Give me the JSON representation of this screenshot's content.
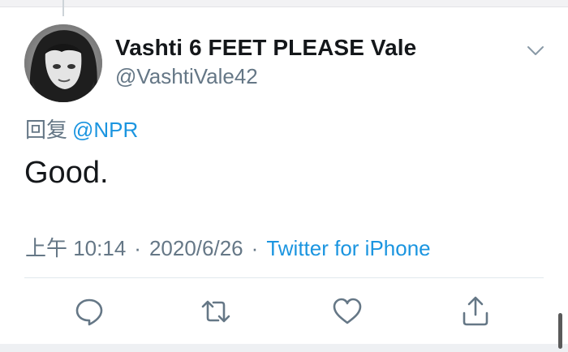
{
  "tweet": {
    "author": {
      "display_name": "Vashti 6 FEET PLEASE Vale",
      "handle": "@VashtiVale42"
    },
    "reply": {
      "prefix": "回复",
      "target": "@NPR"
    },
    "text": "Good.",
    "meta": {
      "time": "上午 10:14",
      "separator": "·",
      "date": "2020/6/26",
      "source": "Twitter for iPhone"
    },
    "actions": {
      "reply_icon": "reply-icon",
      "retweet_icon": "retweet-icon",
      "like_icon": "heart-icon",
      "share_icon": "share-icon"
    }
  },
  "colors": {
    "text_primary": "#14171a",
    "text_secondary": "#657786",
    "link": "#1b95e0",
    "divider": "#e1e8ed"
  }
}
